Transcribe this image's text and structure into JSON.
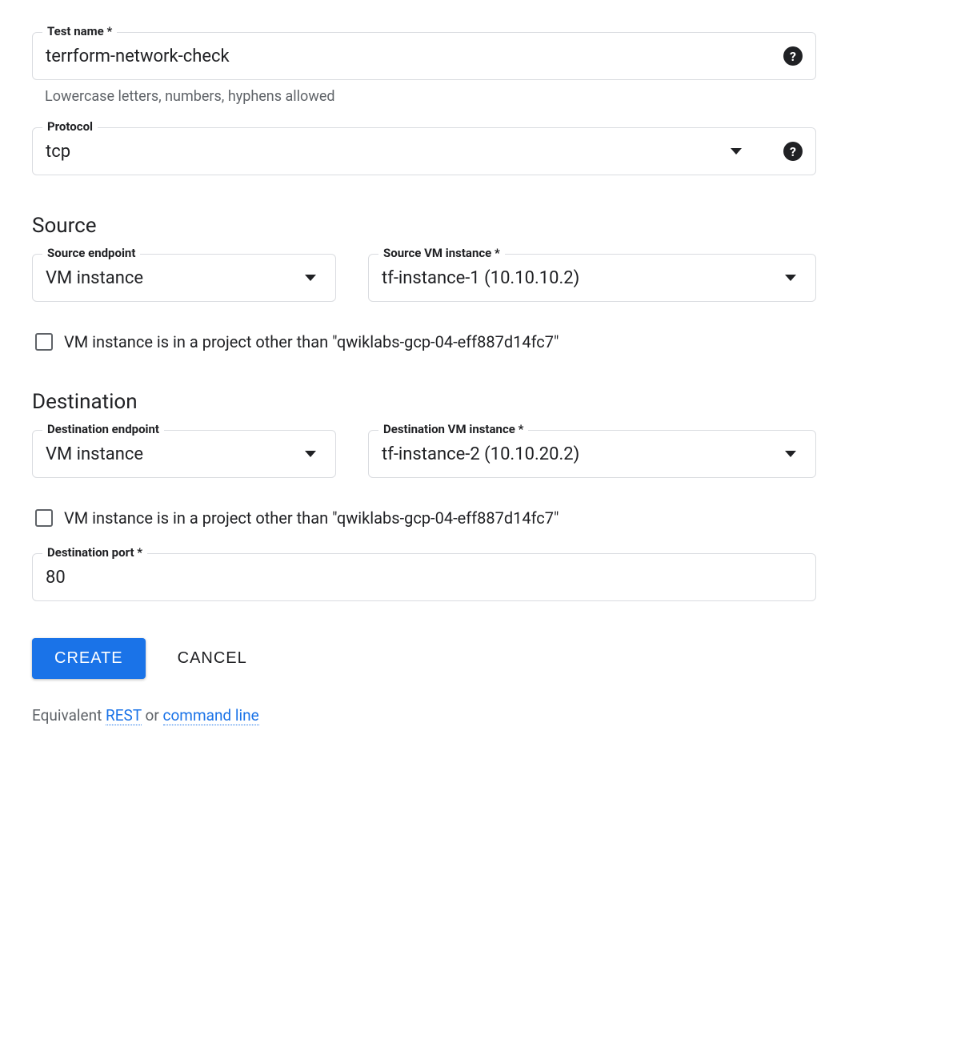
{
  "test_name": {
    "label": "Test name *",
    "value": "terrform-network-check",
    "hint": "Lowercase letters, numbers, hyphens allowed"
  },
  "protocol": {
    "label": "Protocol",
    "value": "tcp"
  },
  "source": {
    "heading": "Source",
    "endpoint": {
      "label": "Source endpoint",
      "value": "VM instance"
    },
    "vm": {
      "label": "Source VM instance *",
      "value": "tf-instance-1 (10.10.10.2)"
    },
    "other_project_label": "VM instance is in a project other than \"qwiklabs-gcp-04-eff887d14fc7\""
  },
  "destination": {
    "heading": "Destination",
    "endpoint": {
      "label": "Destination endpoint",
      "value": "VM instance"
    },
    "vm": {
      "label": "Destination VM instance *",
      "value": "tf-instance-2 (10.10.20.2)"
    },
    "other_project_label": "VM instance is in a project other than \"qwiklabs-gcp-04-eff887d14fc7\"",
    "port": {
      "label": "Destination port *",
      "value": "80"
    }
  },
  "actions": {
    "create": "CREATE",
    "cancel": "CANCEL"
  },
  "equivalent": {
    "prefix": "Equivalent ",
    "rest": "REST",
    "or": " or ",
    "cmd": "command line"
  }
}
